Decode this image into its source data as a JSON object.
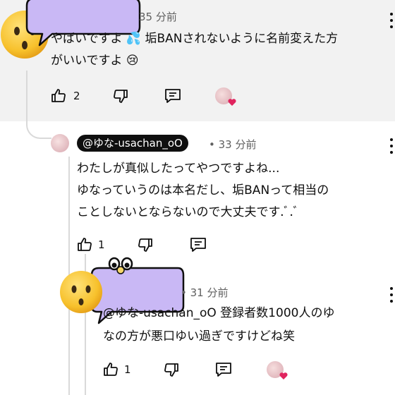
{
  "comment_top": {
    "time": "35 分前",
    "text": "やばいですよ 💦 垢BANされないように名前変えた方\nがいいですよ 😢",
    "likes": "2"
  },
  "reply_1": {
    "handle": "@ゆな-usachan_oO",
    "time": "• 33 分前",
    "text": "わたしが真似したってやつですよね...\nゆなっていうのは本名だし、垢BANって相当の\nことしないとならないので大丈夫です.ﾞ.ﾞ",
    "likes": "1"
  },
  "reply_2": {
    "time": "• 31 分前",
    "text": "@ゆな-usachan_oO 登録者数1000人のゆ\nなの方が悪口ゆい過ぎですけどね笑",
    "likes": "1"
  },
  "icons": [
    "like-icon",
    "dislike-icon",
    "reply-icon",
    "more-icon",
    "heart-icon",
    "emoji-face-icon",
    "speech-bubble-sticker"
  ],
  "colors": {
    "sticker_lavender": "#c9b8f5",
    "heart_red": "#e0245e",
    "emoji_yellow": "#f8c12e",
    "meta_gray": "#606060"
  }
}
